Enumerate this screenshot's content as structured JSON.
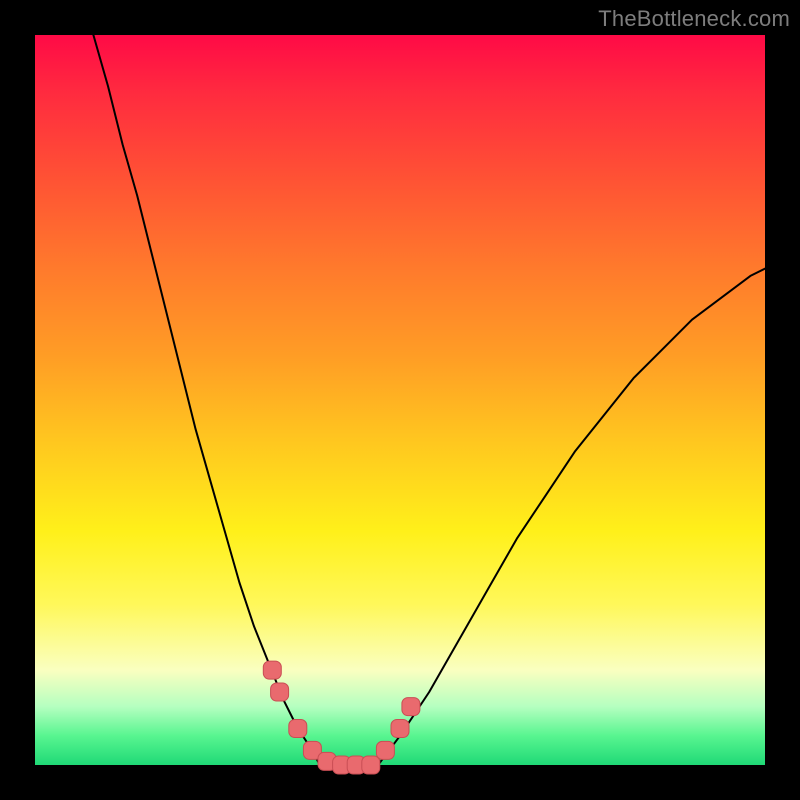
{
  "watermark": "TheBottleneck.com",
  "colors": {
    "curve_stroke": "#000000",
    "marker_fill": "#e96a6e",
    "marker_stroke": "#c94e54",
    "background_gradient_top": "#ff0a46",
    "background_gradient_bottom": "#1fd976",
    "frame": "#000000"
  },
  "chart_data": {
    "type": "line",
    "title": "",
    "xlabel": "",
    "ylabel": "",
    "xlim": [
      0,
      100
    ],
    "ylim": [
      0,
      100
    ],
    "note": "No axis ticks or numeric labels are present in the image; x and y are normalised 0–100 from the visible plot area. Higher y = higher on screen (top of gradient).",
    "series": [
      {
        "name": "left-branch",
        "x": [
          8,
          10,
          12,
          14,
          16,
          18,
          20,
          22,
          24,
          26,
          28,
          30,
          32,
          34,
          36,
          38,
          39
        ],
        "y": [
          100,
          93,
          85,
          78,
          70,
          62,
          54,
          46,
          39,
          32,
          25,
          19,
          14,
          9,
          5,
          2,
          0
        ]
      },
      {
        "name": "floor",
        "x": [
          39,
          41,
          43,
          45,
          47
        ],
        "y": [
          0,
          0,
          0,
          0,
          0
        ]
      },
      {
        "name": "right-branch",
        "x": [
          47,
          50,
          54,
          58,
          62,
          66,
          70,
          74,
          78,
          82,
          86,
          90,
          94,
          98,
          100
        ],
        "y": [
          0,
          4,
          10,
          17,
          24,
          31,
          37,
          43,
          48,
          53,
          57,
          61,
          64,
          67,
          68
        ]
      }
    ],
    "markers": {
      "name": "highlighted-points",
      "x": [
        32.5,
        33.5,
        36,
        38,
        40,
        42,
        44,
        46,
        48,
        50,
        51.5
      ],
      "y": [
        13,
        10,
        5,
        2,
        0.5,
        0,
        0,
        0,
        2,
        5,
        8
      ]
    }
  }
}
